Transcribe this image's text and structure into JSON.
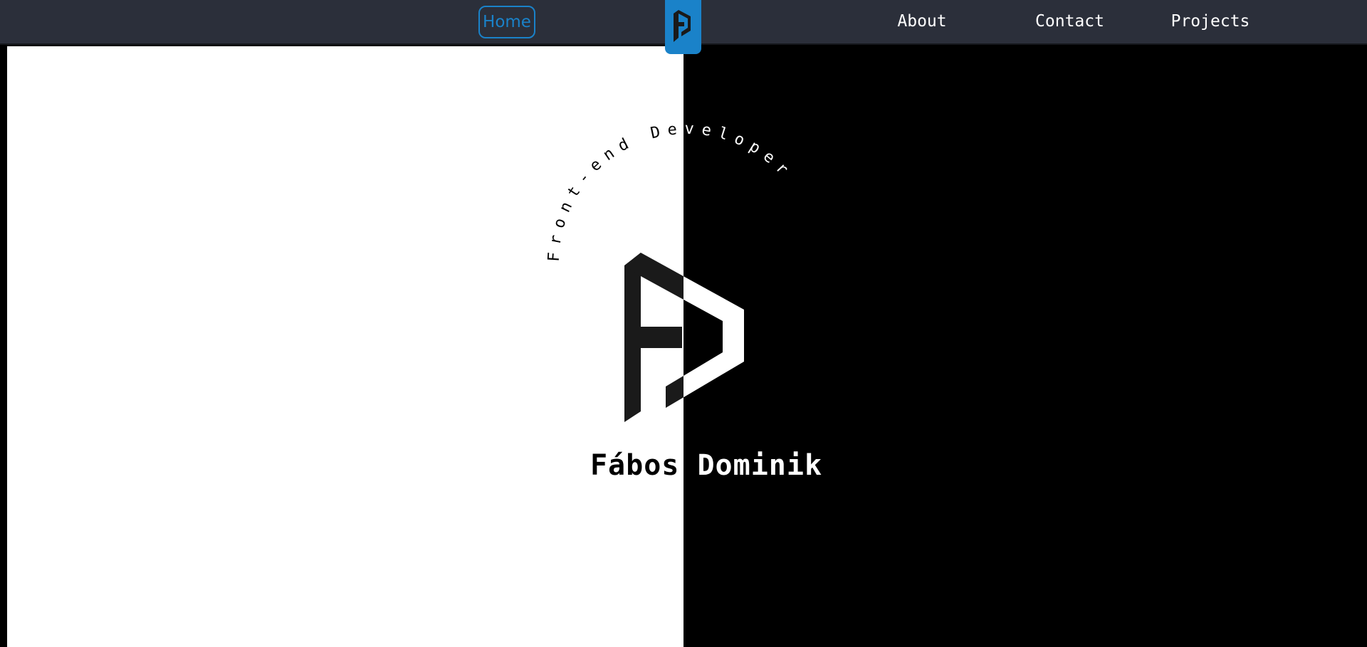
{
  "nav": {
    "home": "Home",
    "about": "About",
    "contact": "Contact",
    "projects": "Projects"
  },
  "hero": {
    "subtitle": "Front-end Developer",
    "name": "Fábos Dominik"
  },
  "colors": {
    "navbar_bg": "#2b2f3a",
    "accent": "#1a82c9",
    "light_half": "#ffffff",
    "dark_half": "#000000",
    "logo_dark": "#1a1a1a"
  },
  "icons": {
    "brand_logo": "fd-monogram-icon"
  }
}
